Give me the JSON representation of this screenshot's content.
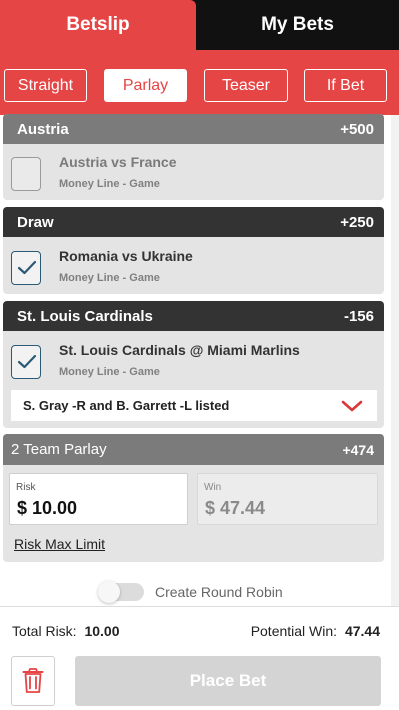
{
  "tabs": {
    "betslip": "Betslip",
    "my_bets": "My Bets",
    "active": "betslip"
  },
  "bet_types": [
    {
      "label": "Straight",
      "active": false
    },
    {
      "label": "Parlay",
      "active": true
    },
    {
      "label": "Teaser",
      "active": false
    },
    {
      "label": "If Bet",
      "active": false
    }
  ],
  "selections": [
    {
      "team": "Austria",
      "odds": "+500",
      "matchup": "Austria vs France",
      "market": "Money Line - Game",
      "checked": false
    },
    {
      "team": "Draw",
      "odds": "+250",
      "matchup": "Romania vs Ukraine",
      "market": "Money Line - Game",
      "checked": true
    },
    {
      "team": "St. Louis Cardinals",
      "odds": "-156",
      "matchup": "St. Louis Cardinals @ Miami Marlins",
      "market": "Money Line - Game",
      "checked": true,
      "pitchers": "S. Gray -R and B. Garrett -L listed"
    }
  ],
  "parlay": {
    "title": "2 Team Parlay",
    "odds": "+474",
    "risk_label": "Risk",
    "risk_value": "$ 10.00",
    "win_label": "Win",
    "win_value": "$ 47.44",
    "max_limit": "Risk Max Limit"
  },
  "round_robin": {
    "label": "Create Round Robin",
    "enabled": false
  },
  "footer": {
    "total_risk_label": "Total Risk:",
    "total_risk": "10.00",
    "potential_win_label": "Potential Win:",
    "potential_win": "47.44",
    "place_bet": "Place Bet"
  },
  "icons": {
    "checkmark": "check-icon",
    "dropdown": "chevron-down-icon",
    "delete": "trash-icon"
  },
  "colors": {
    "accent": "#e64545",
    "dark": "#333333",
    "header_grey": "#7b7b7b",
    "check": "#2b5a75"
  }
}
